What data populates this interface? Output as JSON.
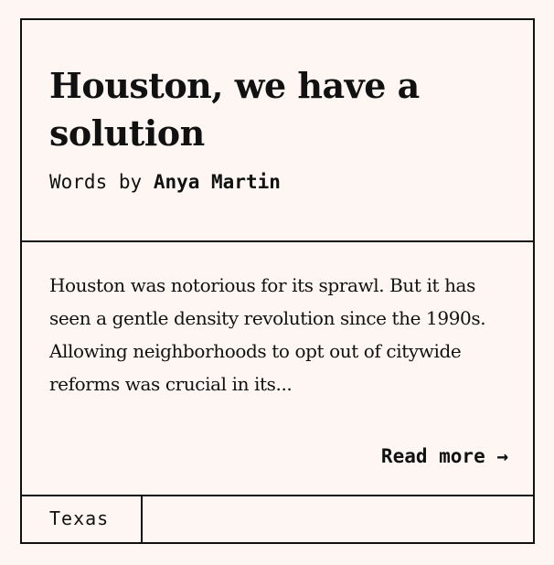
{
  "article": {
    "title": "Houston, we have a solution",
    "byline_prefix": "Words by",
    "author": "Anya Martin",
    "excerpt": "Houston was notorious for its sprawl. But it has seen a gentle density revolution since the 1990s. Allowing neighborhoods to opt out of citywide reforms was crucial in its...",
    "read_more_label": "Read more →",
    "tags": [
      "Texas"
    ]
  },
  "colors": {
    "background": "#fdf6f3",
    "ink": "#111111"
  }
}
